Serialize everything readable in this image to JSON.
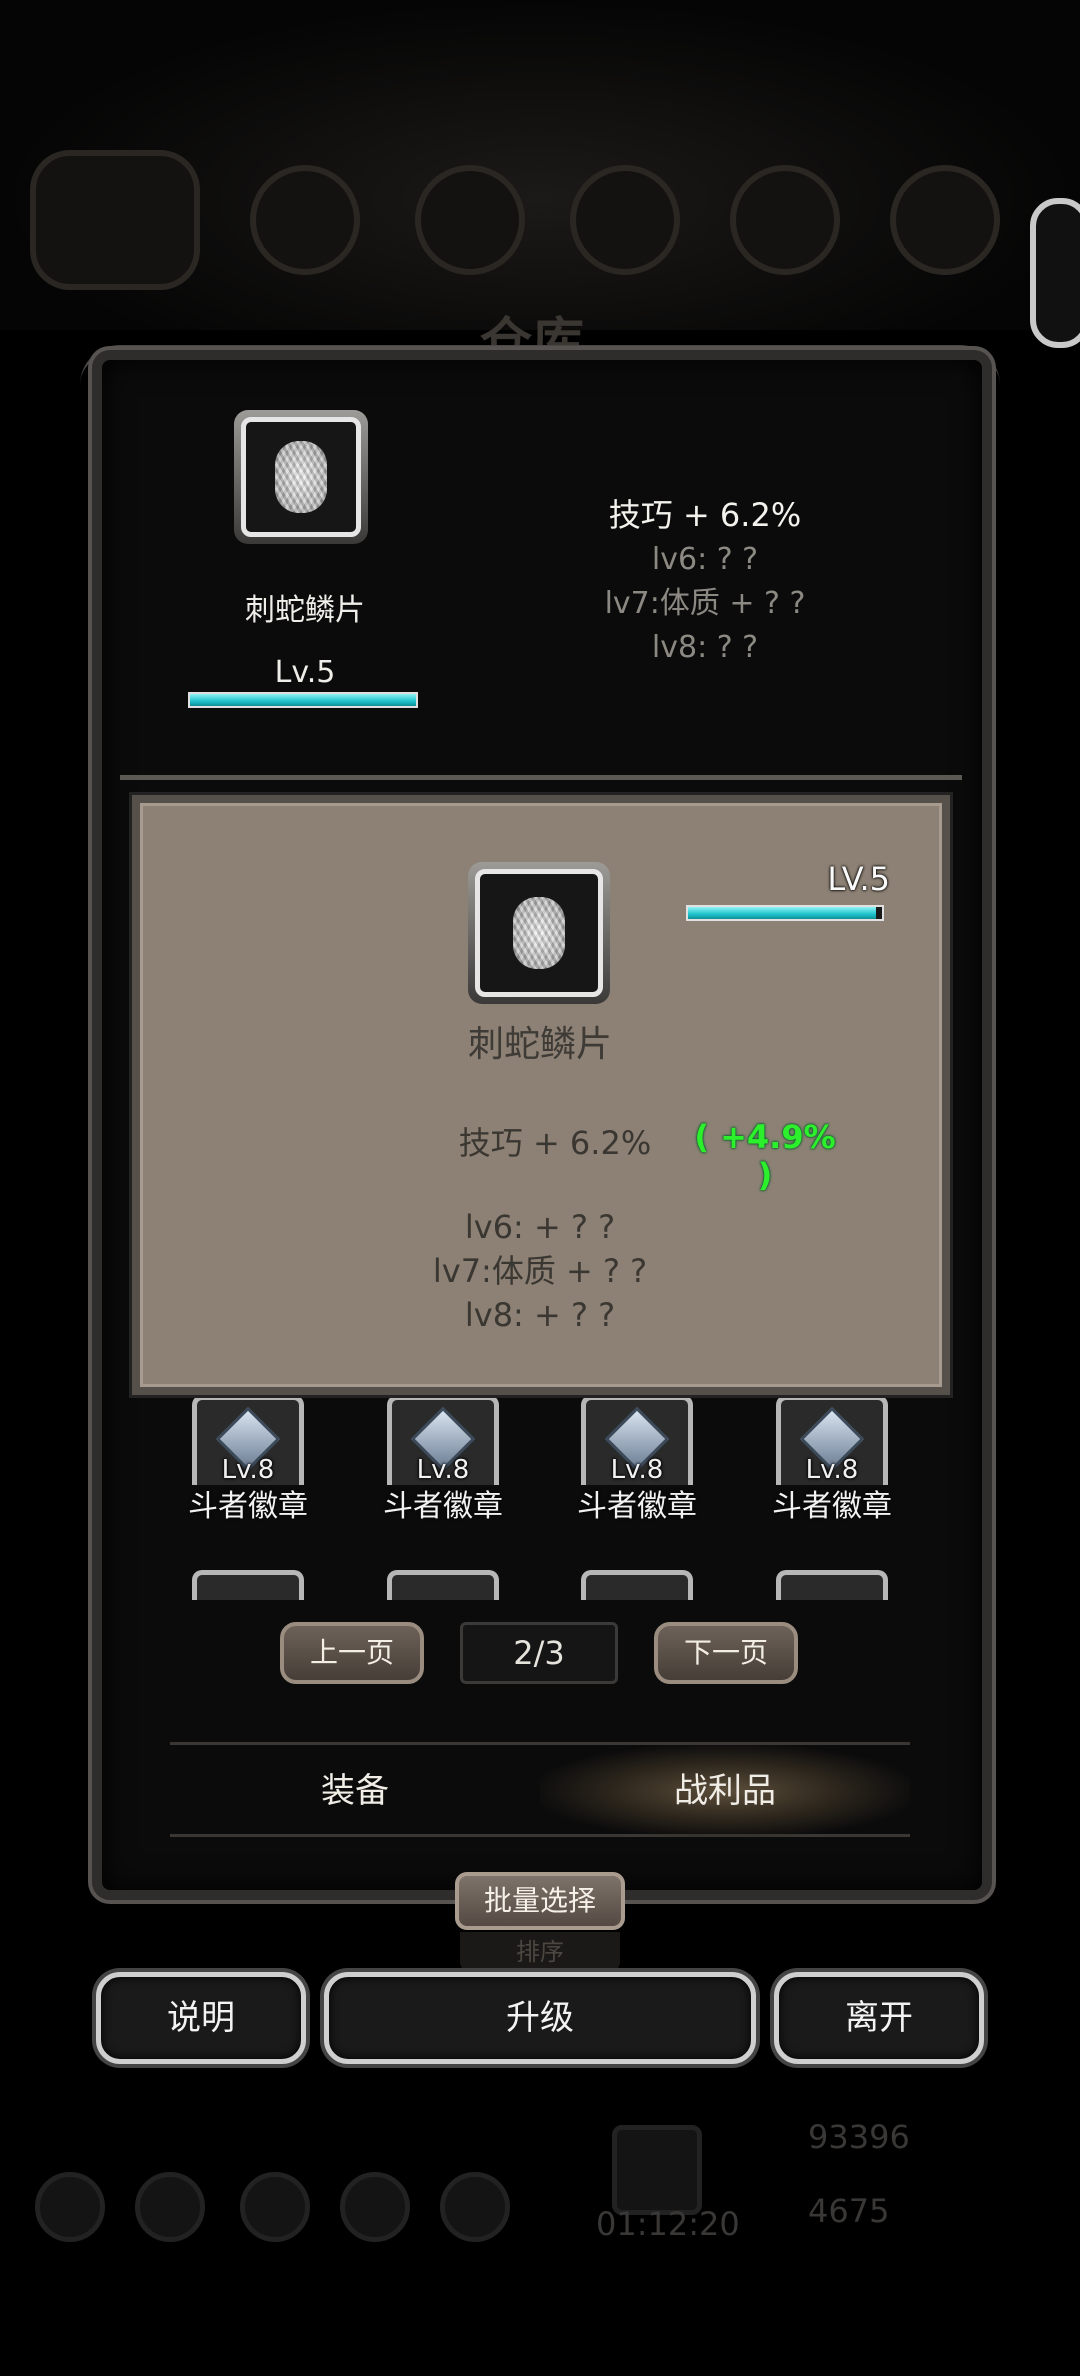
{
  "background": {
    "title": "仓库",
    "gold": "93396",
    "gems": "4675",
    "timer": "01:12:20"
  },
  "header": {
    "item_name": "刺蛇鳞片",
    "level": "Lv.5",
    "level_progress": 1.0,
    "stat_main": "技巧 + 6.2%",
    "stat_lv6": "lv6: ? ?",
    "stat_lv7": "lv7:体质 + ? ?",
    "stat_lv8": "lv8: ? ?"
  },
  "tooltip": {
    "item_name": "刺蛇鳞片",
    "level": "LV.5",
    "level_progress": 0.97,
    "stat": "技巧 + 6.2%",
    "bonus": "( +4.9% )",
    "lines": [
      "lv6: + ? ?",
      "lv7:体质 + ? ?",
      "lv8: + ? ?"
    ]
  },
  "grid": {
    "badges": [
      {
        "level": "Lv.8",
        "name": "斗者徽章"
      },
      {
        "level": "Lv.8",
        "name": "斗者徽章"
      },
      {
        "level": "Lv.8",
        "name": "斗者徽章"
      },
      {
        "level": "Lv.8",
        "name": "斗者徽章"
      }
    ]
  },
  "pagination": {
    "prev_label": "上一页",
    "page": "2/3",
    "next_label": "下一页"
  },
  "tabs": [
    {
      "label": "装备",
      "active": false
    },
    {
      "label": "战利品",
      "active": true
    }
  ],
  "actions": {
    "batch_select": "批量选择",
    "sort": "排序",
    "help": "说明",
    "upgrade": "升级",
    "leave": "离开"
  },
  "colors": {
    "bar_fill": "#1ec3cc",
    "bonus_green": "#2cf02c",
    "tooltip_bg": "#8c8174"
  }
}
